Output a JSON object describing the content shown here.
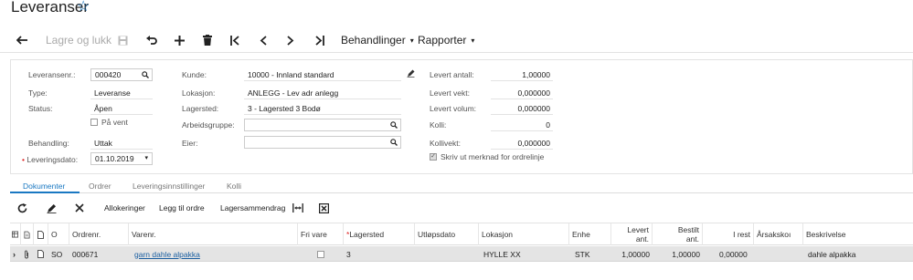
{
  "page": {
    "title": "Leveranser"
  },
  "toolbar": {
    "save_close": "Lagre og lukk",
    "actions": "Behandlinger",
    "reports": "Rapporter"
  },
  "form": {
    "col1": {
      "shipment_nr_label": "Leveransenr.:",
      "shipment_nr": "000420",
      "type_label": "Type:",
      "type": "Leveranse",
      "status_label": "Status:",
      "status": "Åpen",
      "hold_label": "På vent",
      "operation_label": "Behandling:",
      "operation": "Uttak",
      "date_label": "Leveringsdato:",
      "date": "01.10.2019"
    },
    "col2": {
      "customer_label": "Kunde:",
      "customer": "10000 - Innland standard",
      "location_label": "Lokasjon:",
      "location": "ANLEGG - Lev adr anlegg",
      "warehouse_label": "Lagersted:",
      "warehouse": "3 - Lagersted 3 Bodø",
      "workgroup_label": "Arbeidsgruppe:",
      "workgroup": "",
      "owner_label": "Eier:",
      "owner": ""
    },
    "col3": {
      "qty_label": "Levert antall:",
      "qty": "1,00000",
      "weight_label": "Levert vekt:",
      "weight": "0,000000",
      "volume_label": "Levert volum:",
      "volume": "0,000000",
      "packages_label": "Kolli:",
      "packages": "0",
      "pkg_weight_label": "Kollivekt:",
      "pkg_weight": "0,000000",
      "print_note_label": "Skriv ut merknad for ordrelinje"
    }
  },
  "tabs": [
    "Dokumenter",
    "Ordrer",
    "Leveringsinnstillinger",
    "Kolli"
  ],
  "grid_toolbar": {
    "allocations": "Allokeringer",
    "add_order": "Legg til ordre",
    "stock_summary": "Lagersammendrag"
  },
  "grid": {
    "headers": {
      "o": "O",
      "order_nr": "Ordrenr.",
      "item_nr": "Varenr.",
      "free": "Fri vare",
      "warehouse": "Lagersted",
      "expiry": "Utløpsdato",
      "location": "Lokasjon",
      "unit": "Enhe",
      "shipped_qty_1": "Levert",
      "shipped_qty_2": "ant.",
      "ordered_qty_1": "Bestilt",
      "ordered_qty_2": "ant.",
      "remaining": "I rest",
      "reason": "Årsakskoı",
      "description": "Beskrivelse"
    },
    "rows": [
      {
        "o": "SO",
        "order_nr": "000671",
        "item_nr": "garn dahle alpakka",
        "warehouse": "3",
        "expiry": "",
        "location": "HYLLE XX",
        "unit": "STK",
        "shipped": "1,00000",
        "ordered": "1,00000",
        "remaining": "0,00000",
        "reason": "",
        "description": "dahle alpakka"
      }
    ]
  }
}
